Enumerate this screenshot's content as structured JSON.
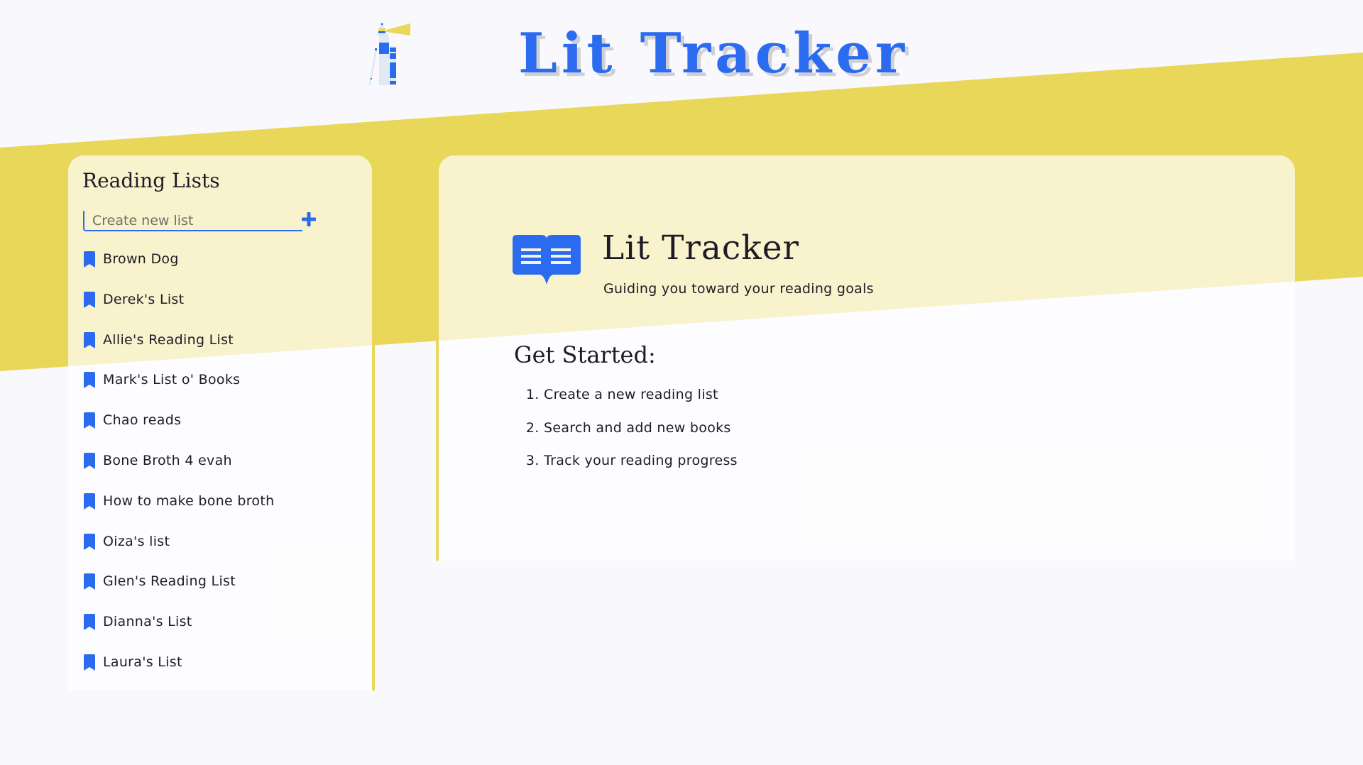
{
  "header": {
    "app_title": "Lit Tracker",
    "logo_icon": "lighthouse-icon"
  },
  "colors": {
    "accent_blue": "#2A6BEF",
    "band_yellow": "#E8D758",
    "panel_cream": "#F6F4DD",
    "page_bg": "#F9F9FD",
    "text_dark": "#1E1B25"
  },
  "sidebar": {
    "title": "Reading Lists",
    "new_list": {
      "value": "",
      "placeholder": "Create new list",
      "add_icon": "plus-icon"
    },
    "item_icon": "bookmark-icon",
    "items": [
      {
        "label": "Brown Dog"
      },
      {
        "label": "Derek's List"
      },
      {
        "label": "Allie's Reading List"
      },
      {
        "label": "Mark's List o' Books"
      },
      {
        "label": "Chao reads"
      },
      {
        "label": "Bone Broth 4 evah"
      },
      {
        "label": "How to make bone broth"
      },
      {
        "label": "Oiza's list"
      },
      {
        "label": "Glen's Reading List"
      },
      {
        "label": "Dianna's List"
      },
      {
        "label": "Laura's List"
      }
    ]
  },
  "main": {
    "icon": "open-book-icon",
    "title": "Lit Tracker",
    "tagline": "Guiding you toward your reading goals",
    "get_started": {
      "heading": "Get Started:",
      "steps": [
        "Create a new reading list",
        "Search and add new books",
        "Track your reading progress"
      ]
    }
  }
}
